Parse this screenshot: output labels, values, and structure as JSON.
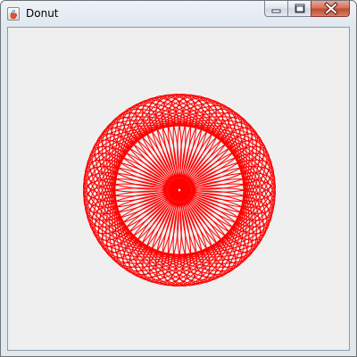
{
  "window": {
    "title": "Donut",
    "app_icon": "java-cup-icon"
  },
  "controls": {
    "minimize_icon": "minimize-icon",
    "maximize_icon": "maximize-icon",
    "close_icon": "close-icon"
  },
  "drawing": {
    "shape": "donut",
    "stroke_color": "#ff0000",
    "background_color": "#efefef",
    "ellipse_count": 72
  }
}
